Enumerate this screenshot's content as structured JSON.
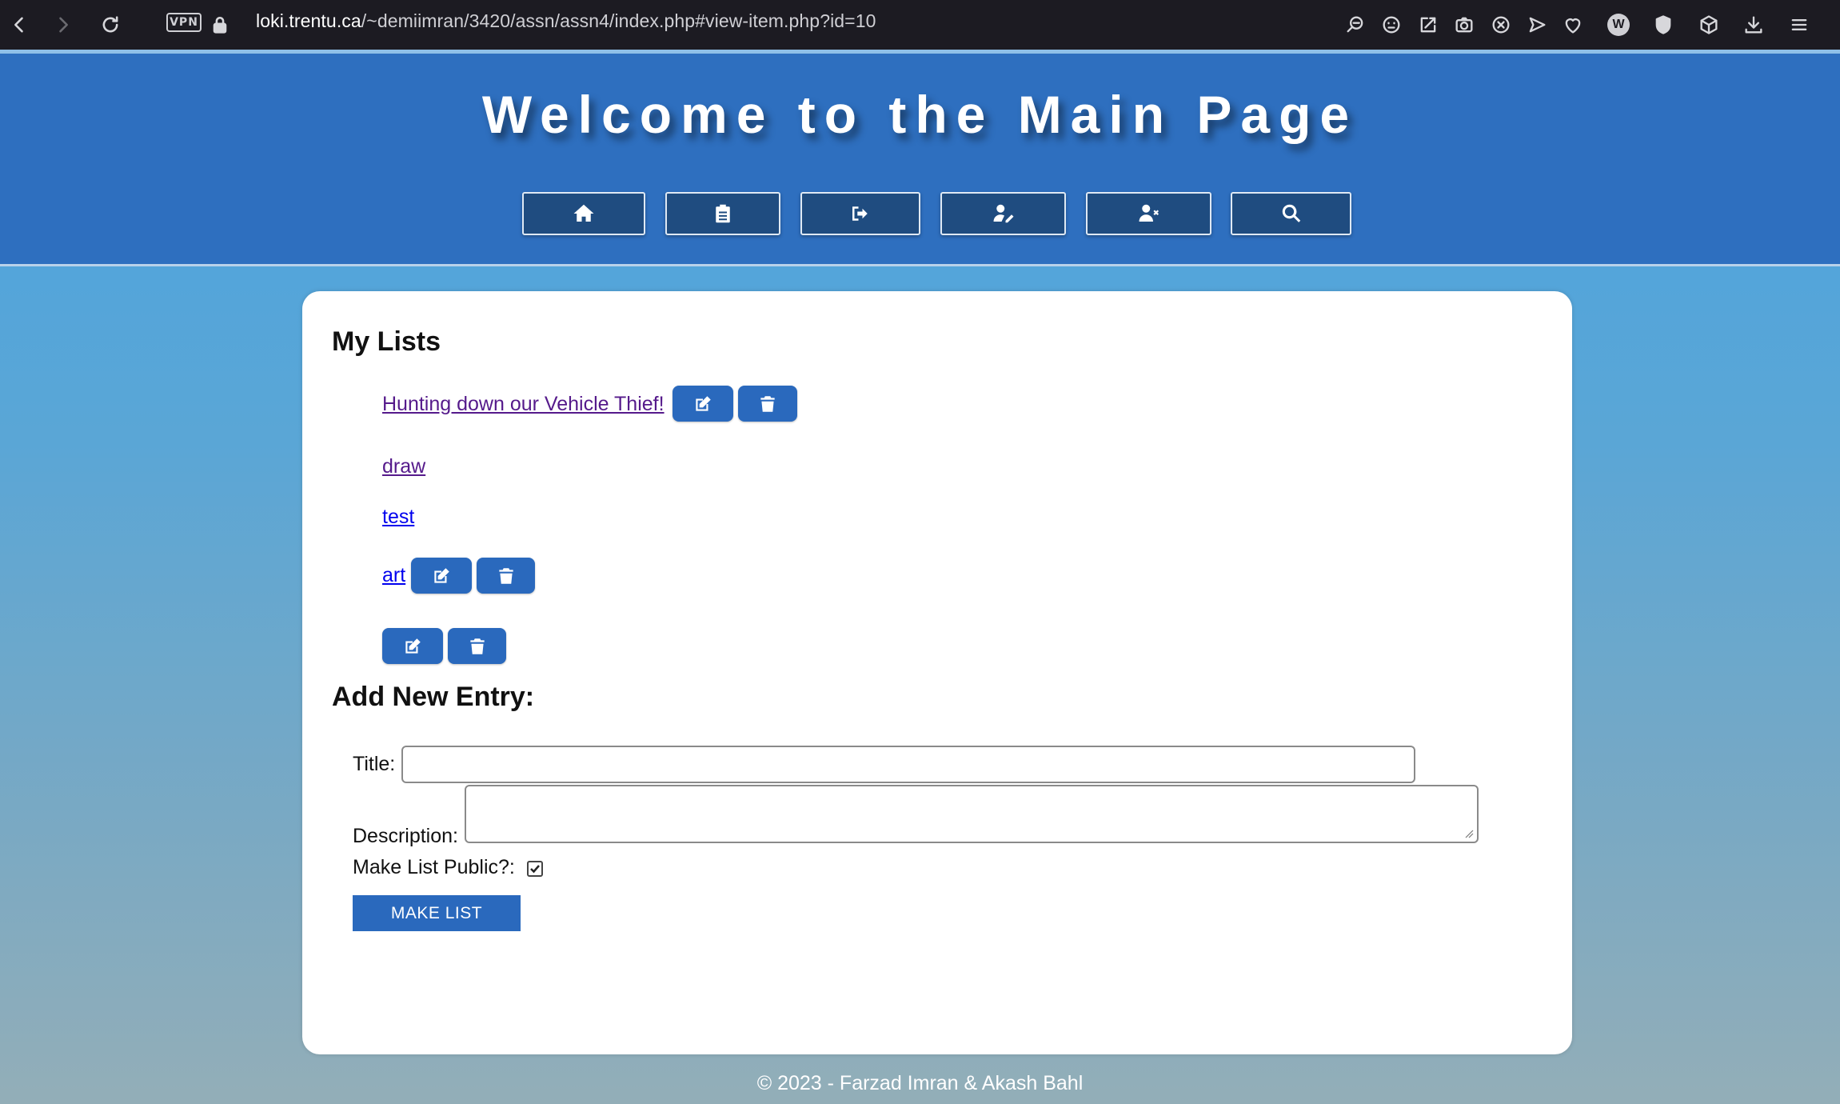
{
  "browser": {
    "vpn_label": "VPN",
    "url_host": "loki.trentu.ca",
    "url_path": "/~demiimran/3420/assn/assn4/index.php#view-item.php?id=10",
    "icons": [
      "back-icon",
      "forward-icon",
      "reload-icon",
      "lock-icon",
      "zoom-icon",
      "emoji-icon",
      "share-icon",
      "camera-icon",
      "close-circle-icon",
      "send-icon",
      "heart-icon",
      "wallet-icon",
      "ublock-icon",
      "box-icon",
      "download-icon",
      "menu-icon"
    ]
  },
  "header": {
    "title": "Welcome to the Main Page",
    "nav": [
      "home-icon",
      "clipboard-icon",
      "logout-icon",
      "user-edit-icon",
      "user-remove-icon",
      "search-icon"
    ]
  },
  "lists": {
    "heading": "My Lists",
    "items": [
      {
        "title": "Hunting down our Vehicle Thief!",
        "visited": true,
        "editable": true
      },
      {
        "title": "draw",
        "visited": true,
        "editable": false
      },
      {
        "title": "test",
        "visited": false,
        "editable": false
      },
      {
        "title": "art",
        "visited": false,
        "editable": true
      },
      {
        "title": "",
        "visited": false,
        "editable": true
      }
    ]
  },
  "form": {
    "heading": "Add New Entry:",
    "title_label": "Title:",
    "title_value": "",
    "description_label": "Description:",
    "description_value": "",
    "public_label": "Make List Public?:",
    "public_checked": true,
    "submit_label": "MAKE LIST"
  },
  "footer": {
    "text": "© 2023 - Farzad Imran & Akash Bahl"
  },
  "colors": {
    "header_bg": "#2e6fbf",
    "nav_btn_bg": "#1f4c80",
    "action_btn_bg": "#2a69bd",
    "browser_bar_bg": "#1c1b22"
  }
}
